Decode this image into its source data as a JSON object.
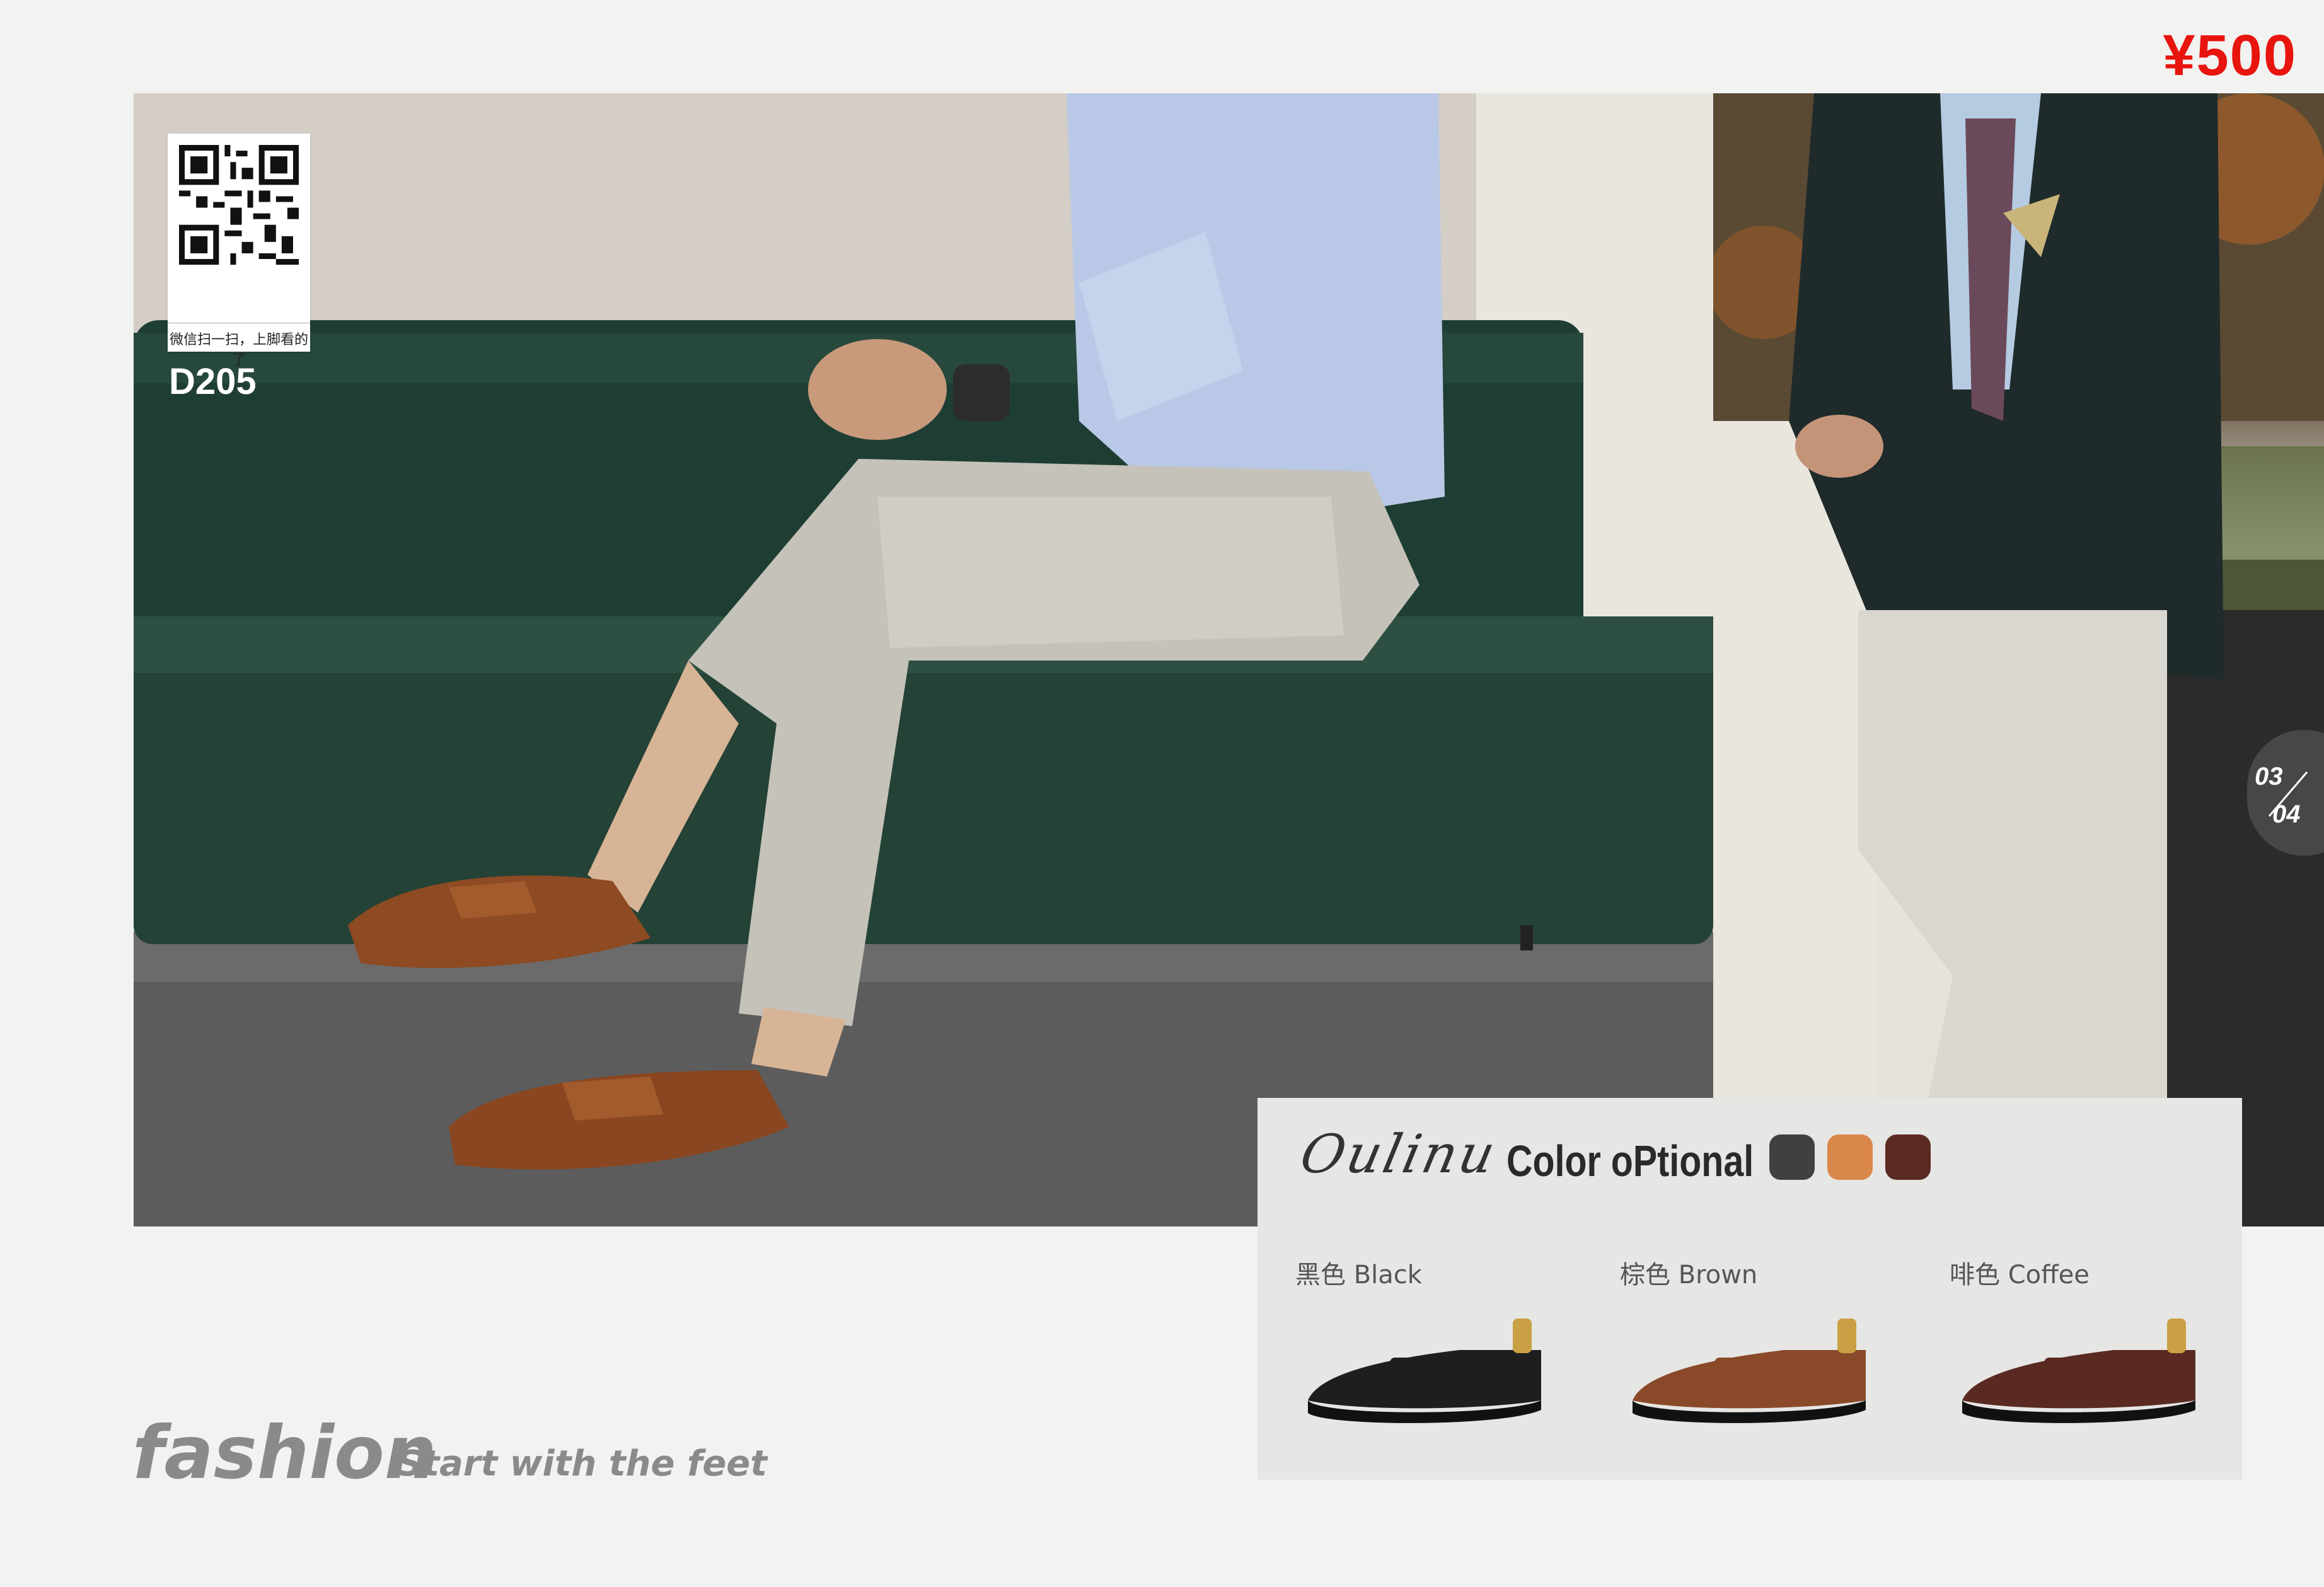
{
  "price": "¥500",
  "model": "D205",
  "qr": {
    "caption": "微信扫一扫，上脚看的了"
  },
  "page": {
    "current": "03",
    "total": "04"
  },
  "color_panel": {
    "brand": "Oulinu",
    "title": "Color oPtional",
    "swatches": [
      "#3f4141",
      "#d9874a",
      "#5a2a23"
    ],
    "variants": [
      {
        "label": "黑色 Black",
        "color": "#1e1e1e"
      },
      {
        "label": "棕色 Brown",
        "color": "#8a4a2a"
      },
      {
        "label": "啡色 Coffee",
        "color": "#5a2a22"
      }
    ]
  },
  "slogan": {
    "main": "fashion",
    "sub": "Start with the feet"
  }
}
